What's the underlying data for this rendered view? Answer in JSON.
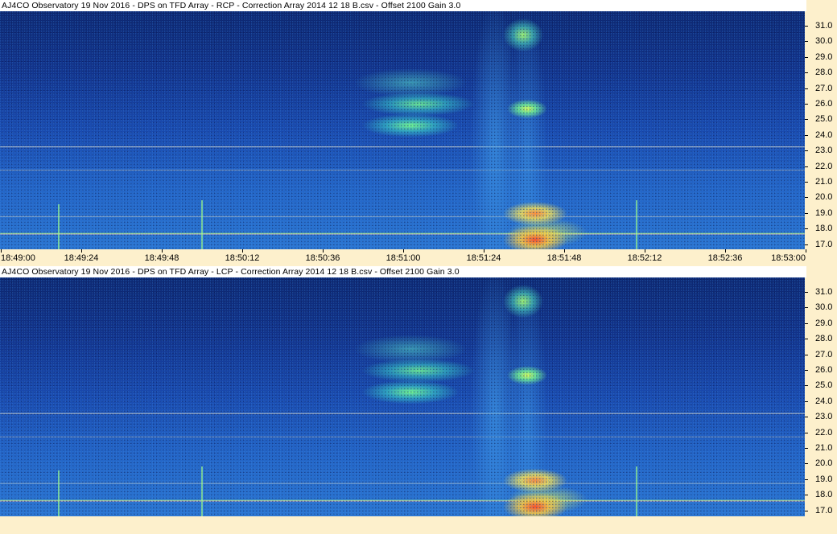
{
  "panels": [
    {
      "id": "rcp",
      "title": "AJ4CO Observatory 19 Nov 2016  -  DPS on TFD Array  -  RCP  -  Correction Array 2014 12 18 B.csv  -  Offset 2100  Gain 3.0"
    },
    {
      "id": "lcp",
      "title": "AJ4CO Observatory 19 Nov 2016  -  DPS on TFD Array  -  LCP  -  Correction Array 2014 12 18 B.csv  -  Offset 2100  Gain 3.0"
    }
  ],
  "frequency_axis": {
    "ticks": [
      "31.0",
      "30.0",
      "29.0",
      "28.0",
      "27.0",
      "26.0",
      "25.0",
      "24.0",
      "23.0",
      "22.0",
      "21.0",
      "20.0",
      "19.0",
      "18.0",
      "17.0"
    ]
  },
  "time_axis": {
    "ticks": [
      "18:49:00",
      "18:49:24",
      "18:49:48",
      "18:50:12",
      "18:50:36",
      "18:51:00",
      "18:51:24",
      "18:51:48",
      "18:52:12",
      "18:52:36",
      "18:53:00"
    ]
  },
  "colors": {
    "background": "#fdf0cc",
    "spectrogram_low": "#0d2872",
    "spectrogram_high": "#ff5030"
  }
}
